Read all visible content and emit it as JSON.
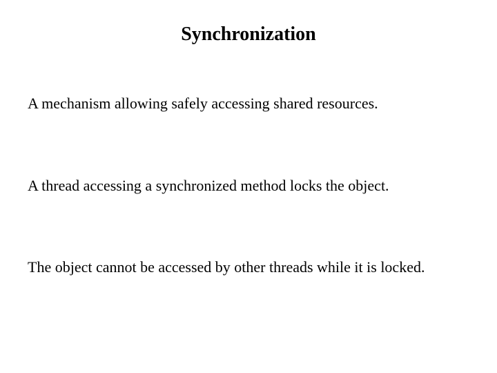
{
  "slide": {
    "title": "Synchronization",
    "paragraphs": [
      "A mechanism allowing safely accessing shared resources.",
      "A thread accessing a synchronized method locks the object.",
      "The object cannot be accessed by other threads while it is locked."
    ]
  }
}
